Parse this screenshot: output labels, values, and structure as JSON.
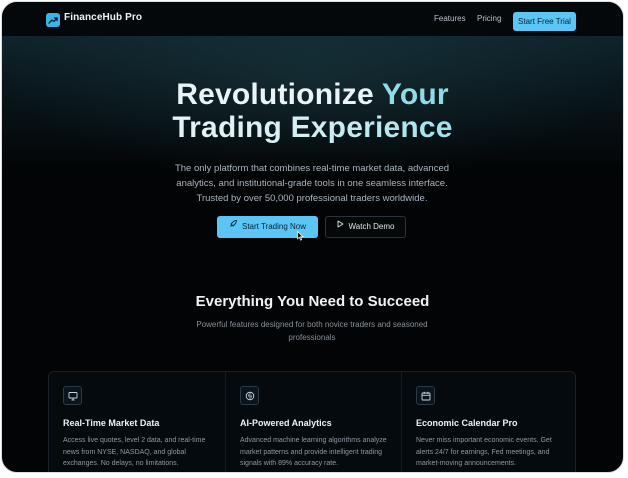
{
  "nav": {
    "brand": "FinanceHub Pro",
    "links": [
      "Features",
      "Pricing"
    ],
    "cta_label": "Start Free Trial",
    "logo_icon": "trending-up-icon"
  },
  "hero": {
    "title_line1_part1": "Revolutionize",
    "title_line1_part2": "Your",
    "title_line2": "Trading Experience",
    "subtitle": "The only platform that combines real-time market data, advanced analytics, and institutional-grade tools in one seamless interface. Trusted by over 50,000 professional traders worldwide.",
    "primary_cta": "Start Trading Now",
    "primary_cta_icon": "rocket-icon",
    "secondary_cta": "Watch Demo",
    "secondary_cta_icon": "play-icon"
  },
  "features_section": {
    "title": "Everything You Need to Succeed",
    "subtitle": "Powerful features designed for both novice traders and seasoned professionals",
    "items": [
      {
        "icon": "monitor-icon",
        "title": "Real-Time Market Data",
        "description": "Access live quotes, level 2 data, and real-time news from NYSE, NASDAQ, and global exchanges. No delays, no limitations."
      },
      {
        "icon": "brain-icon",
        "title": "AI-Powered Analytics",
        "description": "Advanced machine learning algorithms analyze market patterns and provide intelligent trading signals with 89% accuracy rate."
      },
      {
        "icon": "calendar-icon",
        "title": "Economic Calendar Pro",
        "description": "Never miss important economic events. Get alerts 24/7 for earnings, Fed meetings, and market-moving announcements."
      }
    ]
  },
  "colors": {
    "accent": "#5bc6f6",
    "background": "#020405",
    "heading_accent": "#8fdce9"
  }
}
